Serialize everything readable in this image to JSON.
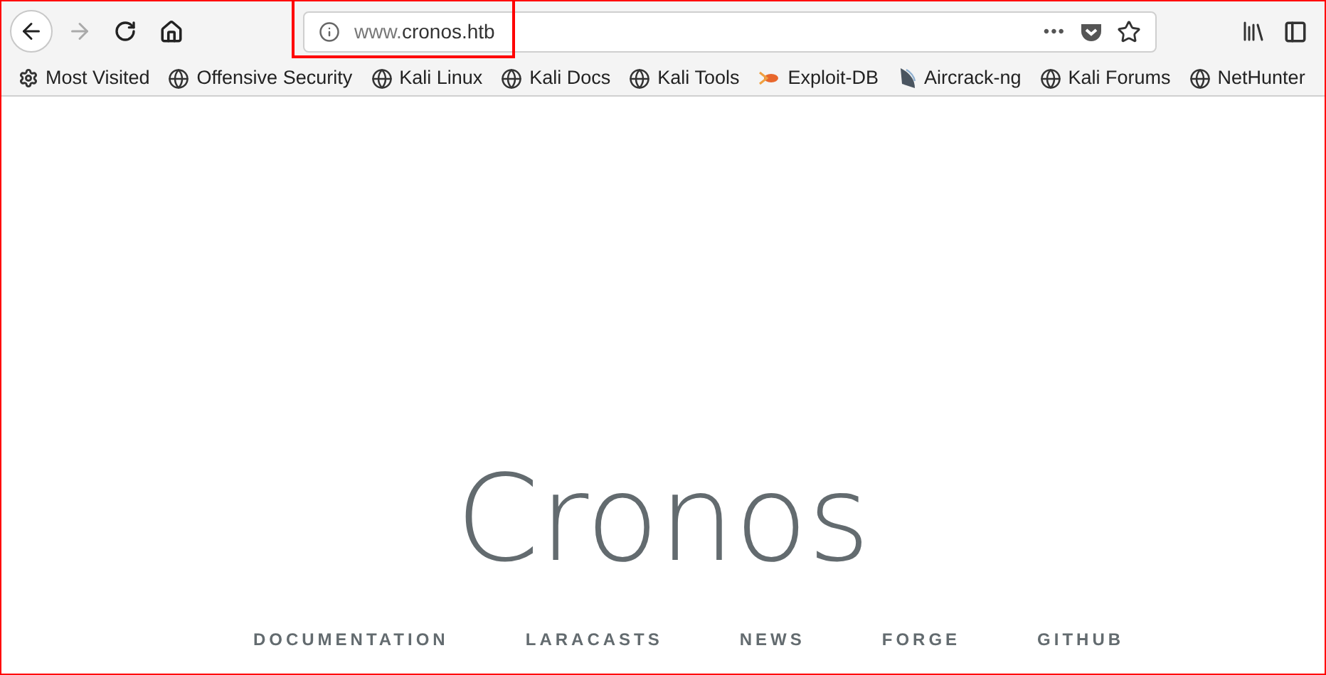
{
  "address_bar": {
    "url_prefix": "www.",
    "url_host": "cronos.htb",
    "more": "•••"
  },
  "bookmarks": [
    {
      "label": "Most Visited",
      "kind": "gear"
    },
    {
      "label": "Offensive Security",
      "kind": "globe"
    },
    {
      "label": "Kali Linux",
      "kind": "globe"
    },
    {
      "label": "Kali Docs",
      "kind": "globe"
    },
    {
      "label": "Kali Tools",
      "kind": "globe"
    },
    {
      "label": "Exploit-DB",
      "kind": "exploit"
    },
    {
      "label": "Aircrack-ng",
      "kind": "dish"
    },
    {
      "label": "Kali Forums",
      "kind": "globe"
    },
    {
      "label": "NetHunter",
      "kind": "globe"
    }
  ],
  "page": {
    "title": "Cronos",
    "links": [
      "DOCUMENTATION",
      "LARACASTS",
      "NEWS",
      "FORGE",
      "GITHUB"
    ]
  }
}
